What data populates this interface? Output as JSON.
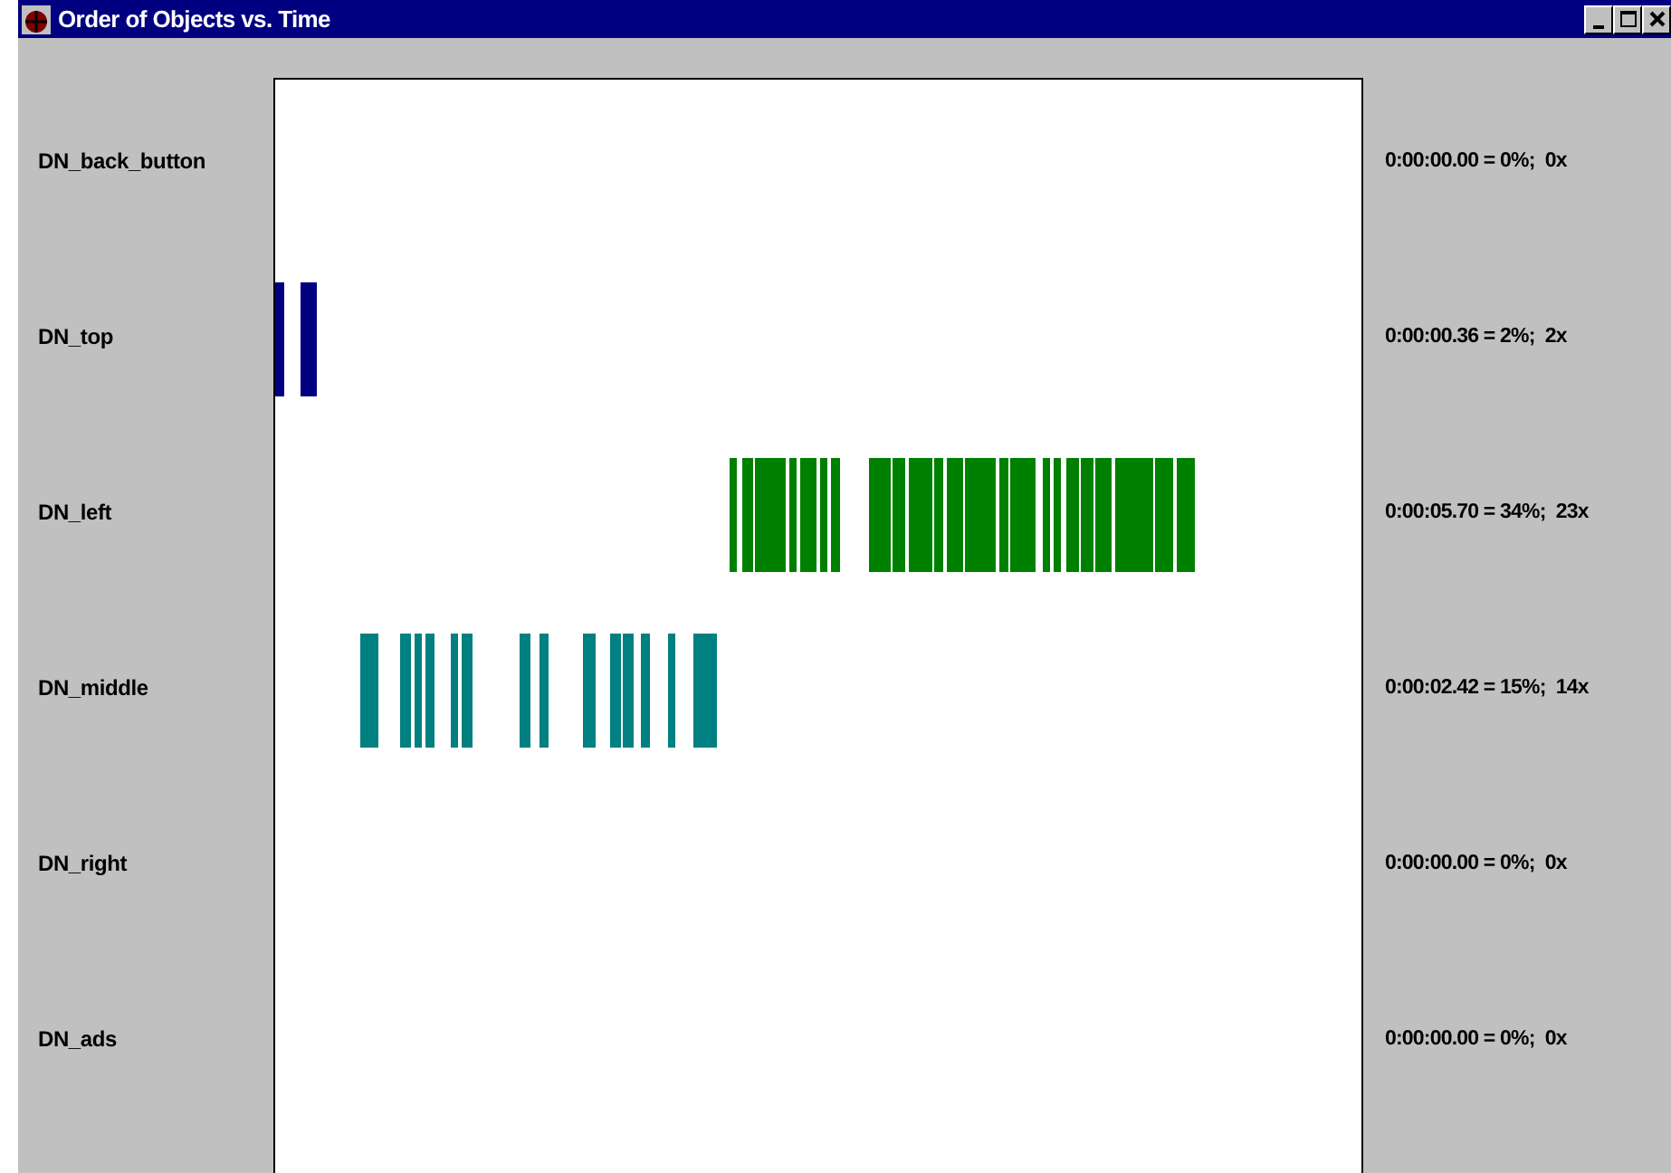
{
  "window": {
    "title": "Order of Objects vs. Time"
  },
  "rows": [
    {
      "name": "DN_back_button",
      "reading": "0:00:00.00 = 0%;  0x"
    },
    {
      "name": "DN_top",
      "reading": "0:00:00.36 = 2%;  2x",
      "color": "#000080"
    },
    {
      "name": "DN_left",
      "reading": "0:00:05.70 = 34%;  23x",
      "color": "#008000"
    },
    {
      "name": "DN_middle",
      "reading": "0:00:02.42 = 15%;  14x",
      "color": "#008080"
    },
    {
      "name": "DN_right",
      "reading": "0:00:00.00 = 0%;  0x"
    },
    {
      "name": "DN_ads",
      "reading": "0:00:00.00 = 0%;  0x"
    }
  ]
}
